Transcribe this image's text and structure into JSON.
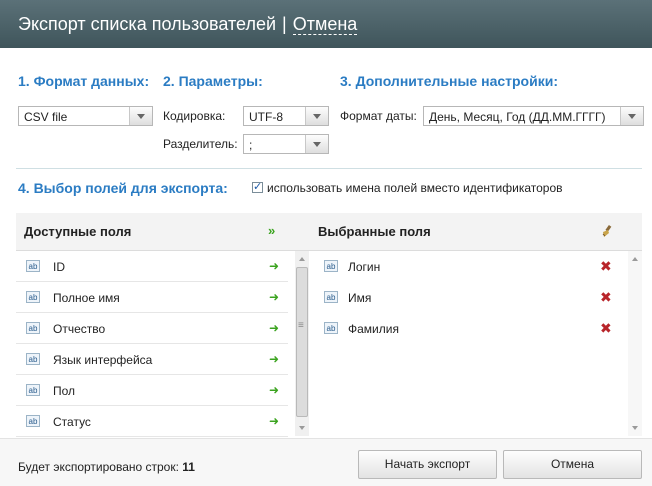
{
  "window": {
    "title": "Экспорт списка пользователей",
    "separator": "|",
    "cancel_link": "Отмена"
  },
  "section1": {
    "title": "1. Формат данных:",
    "format_value": "CSV file"
  },
  "section2": {
    "title": "2. Параметры:",
    "encoding_label": "Кодировка:",
    "encoding_value": "UTF-8",
    "delimiter_label": "Разделитель:",
    "delimiter_value": ";"
  },
  "section3": {
    "title": "3. Дополнительные настройки:",
    "date_format_label": "Формат даты:",
    "date_format_value": "День, Месяц, Год (ДД.ММ.ГГГГ)"
  },
  "section4": {
    "title": "4. Выбор полей для экспорта:",
    "use_names_label": "использовать имена полей вместо идентификаторов",
    "use_names_checked": true
  },
  "available": {
    "header": "Доступные поля",
    "items": [
      {
        "label": "ID"
      },
      {
        "label": "Полное имя"
      },
      {
        "label": "Отчество"
      },
      {
        "label": "Язык интерфейса"
      },
      {
        "label": "Пол"
      },
      {
        "label": "Статус"
      }
    ]
  },
  "selected": {
    "header": "Выбранные поля",
    "items": [
      {
        "label": "Логин"
      },
      {
        "label": "Имя"
      },
      {
        "label": "Фамилия"
      }
    ]
  },
  "icons": {
    "field_type": "ab",
    "add": "arrow-right-icon",
    "remove": "delete-x-icon",
    "add_all": "double-arrow-icon",
    "clear": "brush-icon"
  },
  "footer": {
    "rows_label": "Будет экспортировано строк:",
    "rows_count": "11",
    "start_button": "Начать экспорт",
    "cancel_button": "Отмена"
  },
  "colors": {
    "titlebar": "#4b6168",
    "section_title": "#2b7cc3",
    "add_arrow": "#3ba31f",
    "remove_x": "#b8252a"
  }
}
